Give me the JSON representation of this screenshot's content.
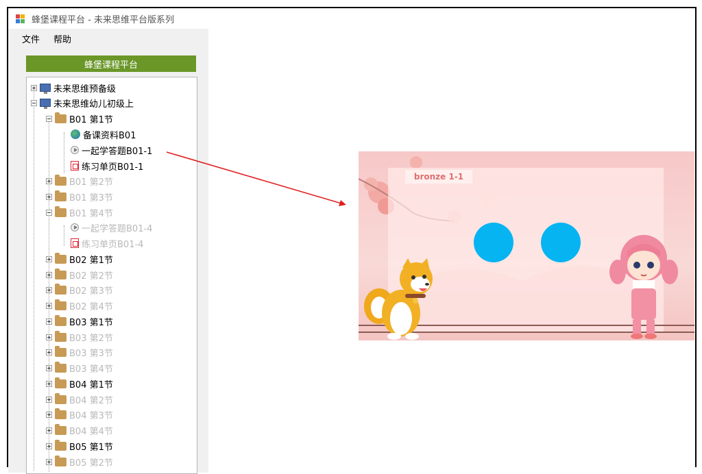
{
  "window": {
    "title": "蜂堡课程平台 - 未来思维平台版系列"
  },
  "menu": {
    "file": "文件",
    "help": "帮助"
  },
  "header": {
    "label": "蜂堡课程平台"
  },
  "tree": {
    "level0": [
      {
        "label": "未来思维预备级"
      },
      {
        "label": "未来思维幼儿初级上"
      }
    ],
    "items": [
      {
        "label": "B01 第1节"
      },
      {
        "label": "备课资料B01"
      },
      {
        "label": "一起学答题B01-1"
      },
      {
        "label": "练习单页B01-1"
      },
      {
        "label": "B01 第2节"
      },
      {
        "label": "B01 第3节"
      },
      {
        "label": "B01 第4节"
      },
      {
        "label": "一起学答题B01-4"
      },
      {
        "label": "练习单页B01-4"
      },
      {
        "label": "B02 第1节"
      },
      {
        "label": "B02 第2节"
      },
      {
        "label": "B02 第3节"
      },
      {
        "label": "B02 第4节"
      },
      {
        "label": "B03 第1节"
      },
      {
        "label": "B03 第2节"
      },
      {
        "label": "B03 第3节"
      },
      {
        "label": "B03 第4节"
      },
      {
        "label": "B04 第1节"
      },
      {
        "label": "B04 第2节"
      },
      {
        "label": "B04 第3节"
      },
      {
        "label": "B04 第4节"
      },
      {
        "label": "B05 第1节"
      },
      {
        "label": "B05 第2节"
      }
    ]
  },
  "game": {
    "badge": "bronze 1-1"
  },
  "colors": {
    "header_green": "#6a9728",
    "circle_blue": "#06b4f2",
    "arrow_red": "#e02020"
  }
}
